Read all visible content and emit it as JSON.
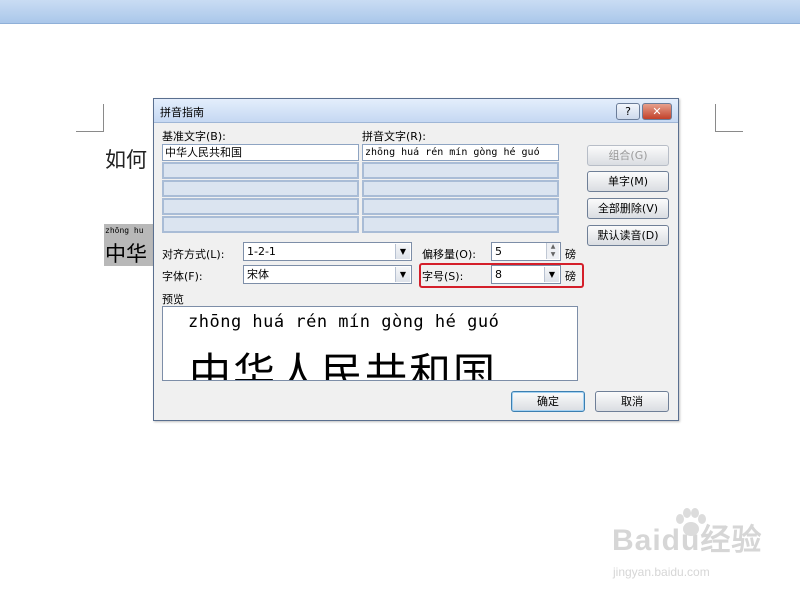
{
  "document": {
    "line1": "如何",
    "selected_ruby": "zhōng hu",
    "selected_base": "中华"
  },
  "dialog": {
    "title": "拼音指南",
    "help_button": "?",
    "close_button": "✕",
    "base_text_label": "基准文字(B):",
    "ruby_text_label": "拼音文字(R):",
    "base_rows": [
      "中华人民共和国",
      "",
      "",
      "",
      ""
    ],
    "ruby_rows": [
      "zhōng huá rén mín gòng hé guó",
      "",
      "",
      "",
      ""
    ],
    "buttons": {
      "combine": "组合(G)",
      "single_char": "单字(M)",
      "clear_all": "全部删除(V)",
      "default_reading": "默认读音(D)",
      "ok": "确定",
      "cancel": "取消"
    },
    "alignment": {
      "label": "对齐方式(L):",
      "value": "1-2-1"
    },
    "offset": {
      "label": "偏移量(O):",
      "value": "5",
      "unit": "磅"
    },
    "font": {
      "label": "字体(F):",
      "value": "宋体"
    },
    "size": {
      "label": "字号(S):",
      "value": "8",
      "unit": "磅"
    },
    "preview": {
      "label": "预览",
      "ruby": "zhōng huá rén mín gòng hé guó",
      "base": "中华人民共和国"
    }
  },
  "watermark": {
    "logo": "Baidu经验",
    "url": "jingyan.baidu.com"
  },
  "colors": {
    "highlight": "#d41f2a",
    "titlebar": "#c5d8f2"
  }
}
